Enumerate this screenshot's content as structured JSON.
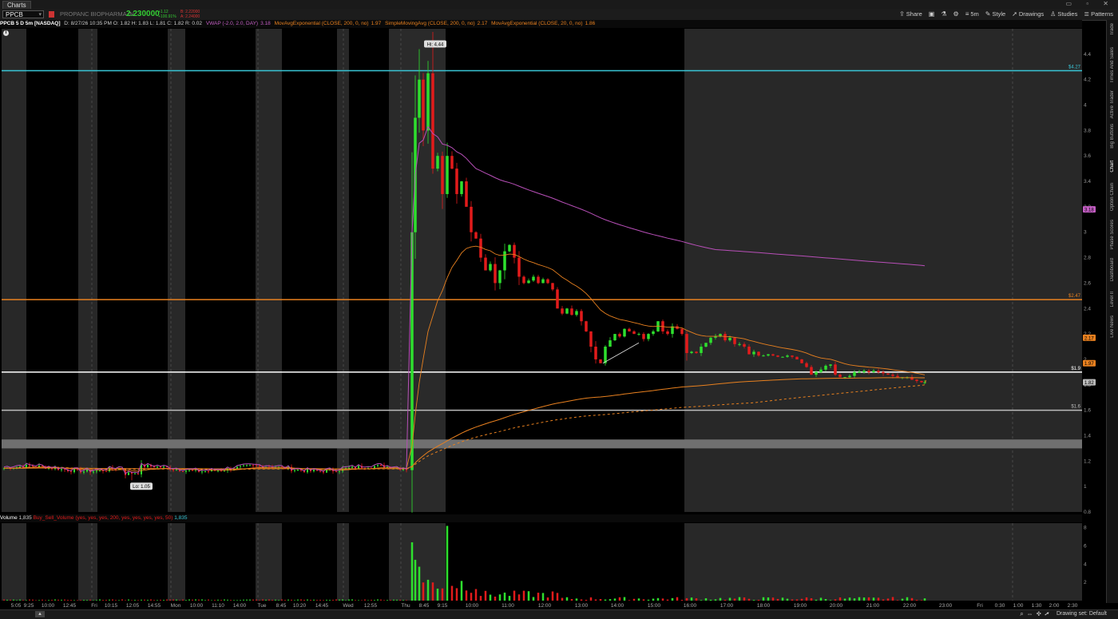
{
  "window": {
    "tab_label": "Charts"
  },
  "toolbar": {
    "symbol": "PPCB",
    "company": "PROPANC BIOPHARMA IN",
    "last": "2.230000",
    "change": "+1.12",
    "change_pct": "+100.91%",
    "bid": "B: 2.22000",
    "ask": "A: 2.24000",
    "buttons": [
      {
        "label": "Share",
        "icon": "share-icon"
      },
      {
        "label": "",
        "icon": "window-icon"
      },
      {
        "label": "",
        "icon": "flask-icon"
      },
      {
        "label": "",
        "icon": "gear-icon"
      },
      {
        "label": "5m",
        "icon": "timeframe-icon"
      },
      {
        "label": "Style",
        "icon": "style-icon"
      },
      {
        "label": "Drawings",
        "icon": "cursor-icon"
      },
      {
        "label": "Studies",
        "icon": "studies-icon"
      },
      {
        "label": "Patterns",
        "icon": "patterns-icon"
      }
    ]
  },
  "studies_bar": {
    "header": "PPCB 5 D 5m [NASDAQ]",
    "ohlc": "D: 8/27/26 10:35 PM  O: 1.82  H: 1.83  L: 1.81  C: 1.82  R: 0.02",
    "vwap": "VWAP (-2.0, 2.0, DAY)",
    "vwap_val": "3.18",
    "ema200": "MovAvgExponential (CLOSE, 200, 0, no)",
    "ema200_val": "1.97",
    "sma200": "SimpleMovingAvg (CLOSE, 200, 0, no)",
    "sma200_val": "2.17",
    "ema20": "MovAvgExponential (CLOSE, 20, 0, no)",
    "ema20_val": "1.86"
  },
  "volume_bar": {
    "label": "Volume",
    "value": "1,835",
    "study": "Buy_Sell_Volume (yes, yes, yes, 200, yes, yes, yes, yes, 50)",
    "study_val": "1,835"
  },
  "sidebar": {
    "labels": [
      "Trade",
      "Times And Sales",
      "Active Trader",
      "Big Buttons",
      "Chart",
      "Option Chain",
      "Phase Scores",
      "Dashboard",
      "Level II",
      "Live News"
    ]
  },
  "statusbar": {
    "drawing_set": "Drawing set: Default"
  },
  "chart_data": {
    "type": "candlestick",
    "price_axis": {
      "ticks": [
        0.8,
        1,
        1.2,
        1.4,
        1.6,
        1.8,
        2,
        2.2,
        2.4,
        2.6,
        2.8,
        3,
        3.2,
        3.4,
        3.6,
        3.8,
        4,
        4.2,
        4.4
      ],
      "range": [
        0.8,
        4.6
      ]
    },
    "volume_axis": {
      "ticks": [
        2,
        4,
        6,
        8
      ],
      "range": [
        0,
        8.5
      ]
    },
    "time_ticks": [
      "5:05",
      "9:25",
      "10:00",
      "12:45",
      "Fri",
      "10:15",
      "12:05",
      "14:55",
      "Mon",
      "10:00",
      "11:10",
      "14:00",
      "Tue",
      "8:45",
      "10:20",
      "14:45",
      "Wed",
      "12:55",
      "Thu",
      "8:45",
      "9:15",
      "10:00",
      "11:00",
      "12:00",
      "13:00",
      "14:00",
      "15:00",
      "16:00",
      "17:00",
      "18:00",
      "19:00",
      "20:00",
      "21:00",
      "22:00",
      "23:00",
      "Fri",
      "0:30",
      "1:00",
      "1:30",
      "2:00",
      "2:30"
    ],
    "hlines": [
      {
        "price": 4.27,
        "label": "$4.27",
        "color": "#39c5d6"
      },
      {
        "price": 2.47,
        "label": "$2.47",
        "color": "#e8801f"
      },
      {
        "price": 1.9,
        "label": "$1.9",
        "color": "#ffffff"
      },
      {
        "price": 1.6,
        "label": "$1.6",
        "color": "#bbbbbb"
      }
    ],
    "zone": {
      "from": 1.3,
      "to": 1.37,
      "color": "#707070"
    },
    "price_badges": [
      {
        "price": 3.18,
        "label": "3.18",
        "color": "#c45ec4"
      },
      {
        "price": 2.17,
        "label": "2.17",
        "color": "#e8801f"
      },
      {
        "price": 1.97,
        "label": "1.97",
        "color": "#e8801f"
      },
      {
        "price": 1.82,
        "label": "1.82",
        "color": "#bbbbbb"
      }
    ],
    "annotations": [
      {
        "text": "Hi: 4.44",
        "price": 4.44
      },
      {
        "text": "Lo: 1.05",
        "price": 1.05
      }
    ],
    "colors": {
      "up": "#2ee02e",
      "down": "#e21b1b",
      "vwap": "#b84fb8",
      "ema": "#e8801f"
    }
  }
}
